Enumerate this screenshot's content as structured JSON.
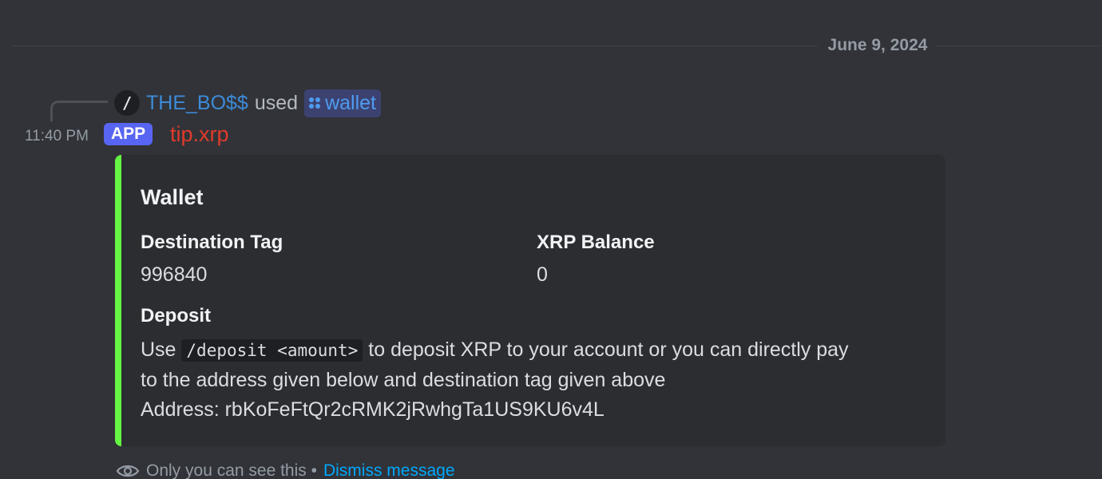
{
  "divider": {
    "date": "June 9, 2024"
  },
  "command": {
    "icon": "slash-command-icon",
    "slash": "/",
    "user": "THE_BO$$",
    "verb": "used",
    "chip_icon": "app-command-icon",
    "name": "wallet"
  },
  "message": {
    "time": "11:40 PM",
    "tag": "APP",
    "author": "tip.xrp"
  },
  "embed": {
    "accent_color": "#65f542",
    "title": "Wallet",
    "fields": [
      {
        "name": "Destination Tag",
        "value": "996840"
      },
      {
        "name": "XRP Balance",
        "value": "0"
      }
    ],
    "deposit": {
      "name": "Deposit",
      "pre": "Use ",
      "code": "/deposit <amount>",
      "line1_post": " to deposit XRP to your account or you can directly pay",
      "line2": "to the address given below and destination tag given above",
      "address": "Address: rbKoFeFtQr2cRMK2jRwhgTa1US9KU6v4L"
    }
  },
  "footer": {
    "icon": "eye-icon",
    "text": "Only you can see this •",
    "dismiss": "Dismiss message"
  }
}
